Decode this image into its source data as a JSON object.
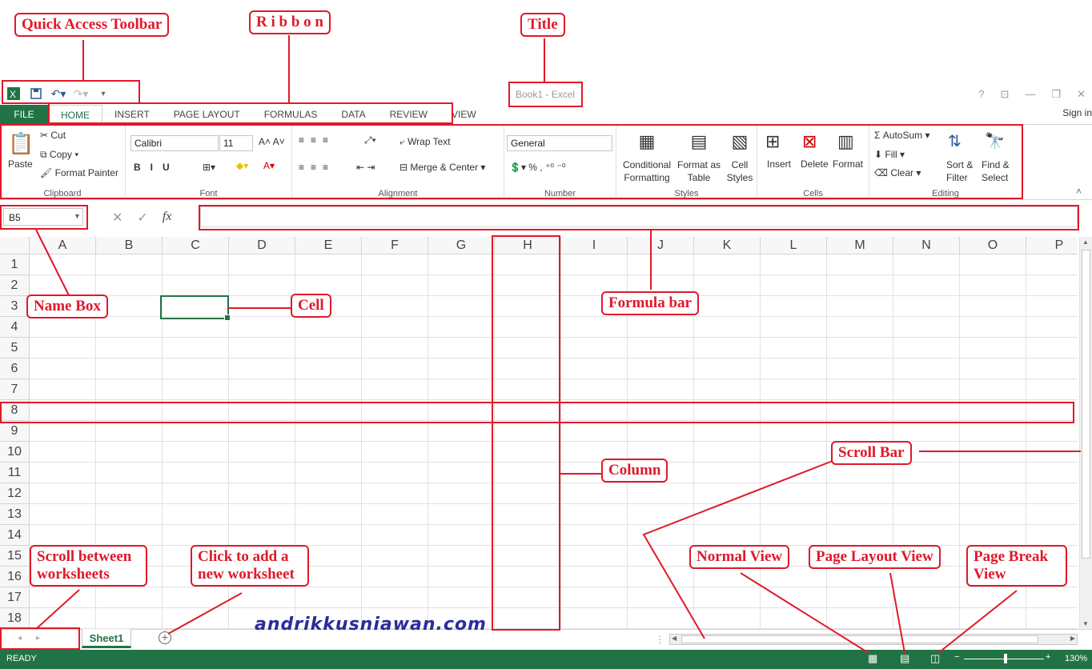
{
  "window": {
    "title": "Book1 - Excel",
    "sign_in": "Sign in",
    "controls": [
      "?",
      "⊡",
      "—",
      "❐",
      "✕"
    ]
  },
  "qat": {
    "icons": [
      "excel-logo-icon",
      "save-icon",
      "undo-icon",
      "redo-icon",
      "customize-icon"
    ]
  },
  "tabs": [
    "FILE",
    "HOME",
    "INSERT",
    "PAGE LAYOUT",
    "FORMULAS",
    "DATA",
    "REVIEW",
    "VIEW"
  ],
  "ribbon": {
    "clipboard": {
      "label": "Clipboard",
      "paste": "Paste",
      "cut": "Cut",
      "copy": "Copy",
      "format_painter": "Format Painter"
    },
    "font": {
      "label": "Font",
      "name": "Calibri",
      "size": "11"
    },
    "alignment": {
      "label": "Alignment",
      "wrap": "Wrap Text",
      "merge": "Merge & Center"
    },
    "number": {
      "label": "Number",
      "format": "General"
    },
    "styles": {
      "label": "Styles",
      "conditional": "Conditional Formatting",
      "format_table": "Format as Table",
      "cell_styles": "Cell Styles"
    },
    "cells": {
      "label": "Cells",
      "insert": "Insert",
      "delete": "Delete",
      "format": "Format"
    },
    "editing": {
      "label": "Editing",
      "autosum": "AutoSum",
      "fill": "Fill",
      "clear": "Clear",
      "sort": "Sort & Filter",
      "find": "Find & Select"
    }
  },
  "namebox": "B5",
  "columns": [
    "A",
    "B",
    "C",
    "D",
    "E",
    "F",
    "G",
    "H",
    "I",
    "J",
    "K",
    "L",
    "M",
    "N",
    "O",
    "P"
  ],
  "rows": [
    "1",
    "2",
    "3",
    "4",
    "5",
    "6",
    "7",
    "8",
    "9",
    "10",
    "11",
    "12",
    "13",
    "14",
    "15",
    "16",
    "17",
    "18"
  ],
  "sheet": {
    "tab": "Sheet1"
  },
  "status": {
    "ready": "READY",
    "zoom": "130%"
  },
  "annotations": {
    "qat": "Quick Access Toolbar",
    "ribbon": "R i b b o n",
    "title": "Title",
    "namebox": "Name Box",
    "cell": "Cell",
    "formula": "Formula bar",
    "column": "Column",
    "scrollbar": "Scroll Bar",
    "scroll_ws": "Scroll between worksheets",
    "add_ws": "Click to add a new worksheet",
    "normal": "Normal View",
    "layout": "Page Layout View",
    "pagebreak": "Page Break View"
  },
  "watermark": "andrikkusniawan.com",
  "colors": {
    "excel_green": "#217346",
    "annotation_red": "#e0192a",
    "watermark_blue": "#2e2b99"
  }
}
